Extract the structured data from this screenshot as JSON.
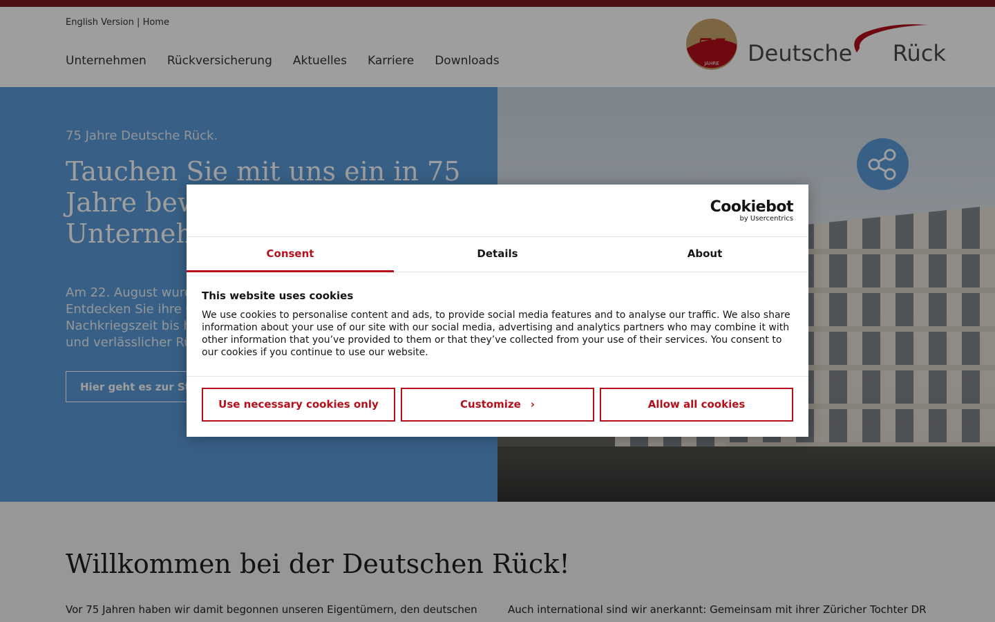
{
  "utility": {
    "english": "English Version",
    "separator": "|",
    "home": "Home"
  },
  "nav": [
    "Unternehmen",
    "Rückversicherung",
    "Aktuelles",
    "Karriere",
    "Downloads"
  ],
  "logo": {
    "badge": "75",
    "badge_sub": "JAHRE",
    "left": "Deutsche",
    "right": "Rück"
  },
  "hero": {
    "kicker": "75 Jahre Deutsche Rück.",
    "title": "Tauchen Sie mit uns ein in 75 Jahre bewegte Unternehmensgeschichte.",
    "text": "Am 22. August wurde die Deutsche Rück 75 Jahre alt. Entdecken Sie ihre Geschichte – von den Anfängen in der Nachkriegszeit bis hin zu dem, was sie heute ist: ein starker und verlässlicher Rückversicherer.",
    "button": "Hier geht es zur Story"
  },
  "welcome": {
    "title": "Willkommen bei der Deutschen Rück!",
    "col1": "Vor 75 Jahren haben wir damit begonnen unseren Eigentümern, den deutschen",
    "col2": "Auch international sind wir anerkannt: Gemeinsam mit ihrer Züricher Tochter DR"
  },
  "cookie": {
    "brand": "Cookiebot",
    "brand_sub": "by Usercentrics",
    "tabs": [
      "Consent",
      "Details",
      "About"
    ],
    "heading": "This website uses cookies",
    "text": "We use cookies to personalise content and ads, to provide social media features and to analyse our traffic. We also share information about your use of our site with our social media, advertising and analytics partners who may combine it with other information that you’ve provided to them or that they’ve collected from your use of their services. You consent to our cookies if you continue to use our website.",
    "btn_necessary": "Use necessary cookies only",
    "btn_customize": "Customize",
    "btn_allow": "Allow all cookies"
  },
  "colors": {
    "accent": "#b3101c",
    "topbar": "#7a1a1f",
    "hero_blue": "#5b9cd8"
  }
}
